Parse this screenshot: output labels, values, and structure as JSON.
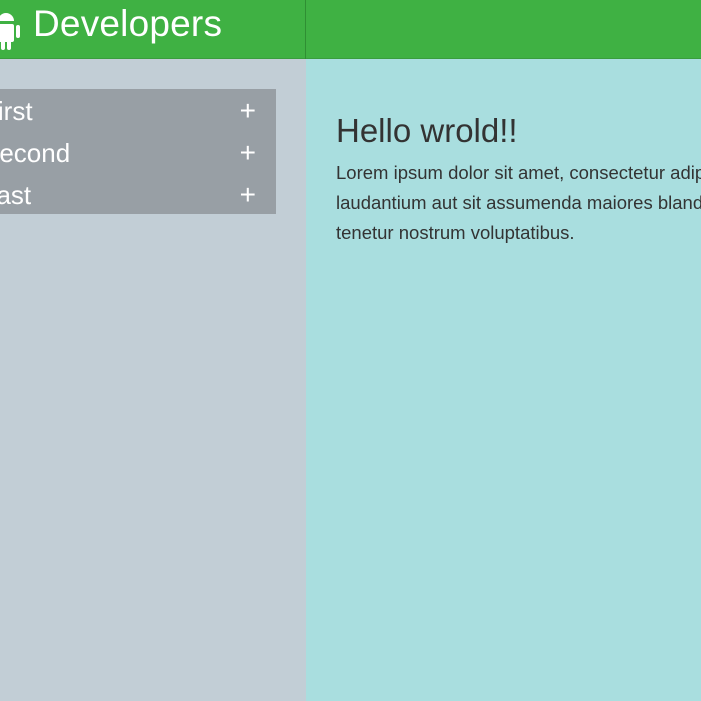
{
  "header": {
    "brand": "Developers",
    "logo_icon": "android-icon",
    "background": "#3fb143"
  },
  "sidebar": {
    "background": "#c2ced6",
    "menu_background": "#989fa5",
    "items": [
      {
        "label": "First",
        "toggle": "+"
      },
      {
        "label": "Second",
        "toggle": "+"
      },
      {
        "label": "Last",
        "toggle": "+"
      }
    ]
  },
  "content": {
    "background": "#a9dedf",
    "title": "Hello wrold!!",
    "body_lines": [
      "Lorem ipsum dolor sit amet, consectetur adipisicing elit. Ratione",
      "laudantium aut sit assumenda maiores blanditiis quam earum",
      "tenetur nostrum voluptatibus."
    ]
  }
}
